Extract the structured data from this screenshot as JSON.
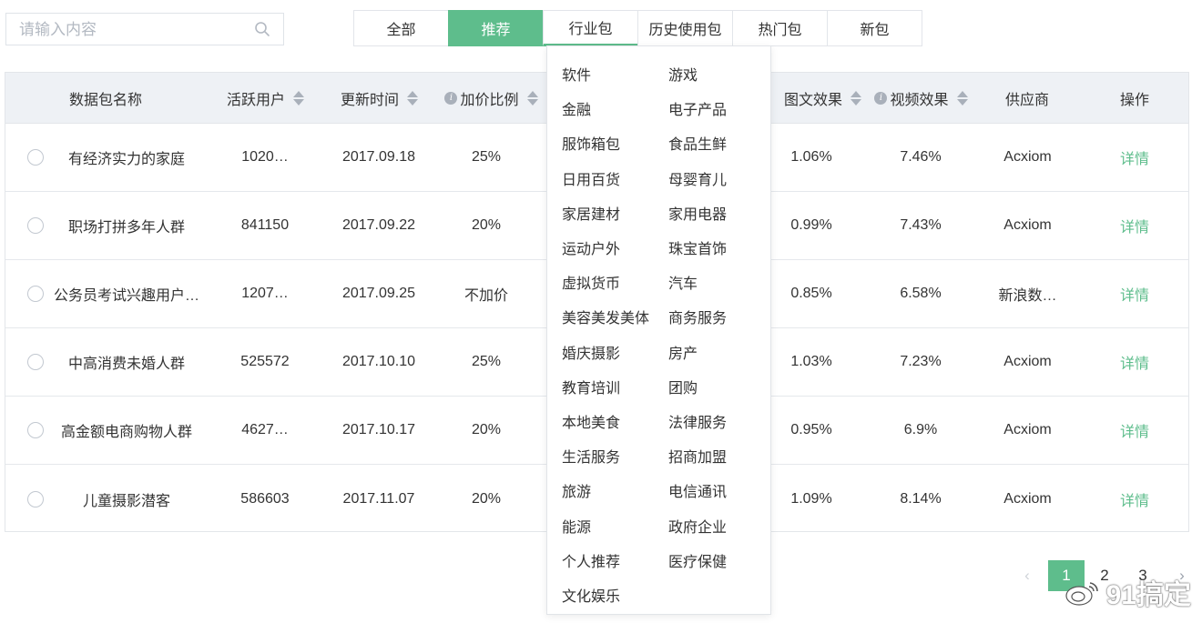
{
  "search": {
    "placeholder": "请输入内容",
    "icon": "search-icon"
  },
  "tabs": [
    {
      "label": "全部",
      "state": "normal"
    },
    {
      "label": "推荐",
      "state": "active"
    },
    {
      "label": "行业包",
      "state": "open"
    },
    {
      "label": "历史使用包",
      "state": "normal"
    },
    {
      "label": "热门包",
      "state": "normal"
    },
    {
      "label": "新包",
      "state": "normal"
    }
  ],
  "table": {
    "headers": {
      "name": "数据包名称",
      "active_users": "活跃用户",
      "updated": "更新时间",
      "markup": "加价比例",
      "image_text": "图文效果",
      "video": "视频效果",
      "supplier": "供应商",
      "action": "操作"
    },
    "rows": [
      {
        "name": "有经济实力的家庭",
        "active_users": "1020…",
        "updated": "2017.09.18",
        "markup": "25%",
        "image_text": "1.06%",
        "video": "7.46%",
        "supplier": "Acxiom",
        "action": "详情"
      },
      {
        "name": "职场打拼多年人群",
        "active_users": "841150",
        "updated": "2017.09.22",
        "markup": "20%",
        "image_text": "0.99%",
        "video": "7.43%",
        "supplier": "Acxiom",
        "action": "详情"
      },
      {
        "name": "公务员考试兴趣用户…",
        "active_users": "1207…",
        "updated": "2017.09.25",
        "markup": "不加价",
        "image_text": "0.85%",
        "video": "6.58%",
        "supplier": "新浪数…",
        "action": "详情"
      },
      {
        "name": "中高消费未婚人群",
        "active_users": "525572",
        "updated": "2017.10.10",
        "markup": "25%",
        "image_text": "1.03%",
        "video": "7.23%",
        "supplier": "Acxiom",
        "action": "详情"
      },
      {
        "name": "高金额电商购物人群",
        "active_users": "4627…",
        "updated": "2017.10.17",
        "markup": "20%",
        "image_text": "0.95%",
        "video": "6.9%",
        "supplier": "Acxiom",
        "action": "详情"
      },
      {
        "name": "儿童摄影潜客",
        "active_users": "586603",
        "updated": "2017.11.07",
        "markup": "20%",
        "image_text": "1.09%",
        "video": "8.14%",
        "supplier": "Acxiom",
        "action": "详情"
      }
    ]
  },
  "industry_menu": [
    [
      "软件",
      "游戏"
    ],
    [
      "金融",
      "电子产品"
    ],
    [
      "服饰箱包",
      "食品生鲜"
    ],
    [
      "日用百货",
      "母婴育儿"
    ],
    [
      "家居建材",
      "家用电器"
    ],
    [
      "运动户外",
      "珠宝首饰"
    ],
    [
      "虚拟货币",
      "汽车"
    ],
    [
      "美容美发美体",
      "商务服务"
    ],
    [
      "婚庆摄影",
      "房产"
    ],
    [
      "教育培训",
      "团购"
    ],
    [
      "本地美食",
      "法律服务"
    ],
    [
      "生活服务",
      "招商加盟"
    ],
    [
      "旅游",
      "电信通讯"
    ],
    [
      "能源",
      "政府企业"
    ],
    [
      "个人推荐",
      "医疗保健"
    ],
    [
      "文化娱乐"
    ]
  ],
  "pagination": {
    "prev": "‹",
    "pages": [
      "1",
      "2",
      "3"
    ],
    "current": "1",
    "next": "›"
  },
  "watermark": {
    "text": "91搞定"
  },
  "colors": {
    "accent": "#5ebd8c",
    "header_bg": "#eef1f5",
    "border": "#e3e6ea"
  }
}
